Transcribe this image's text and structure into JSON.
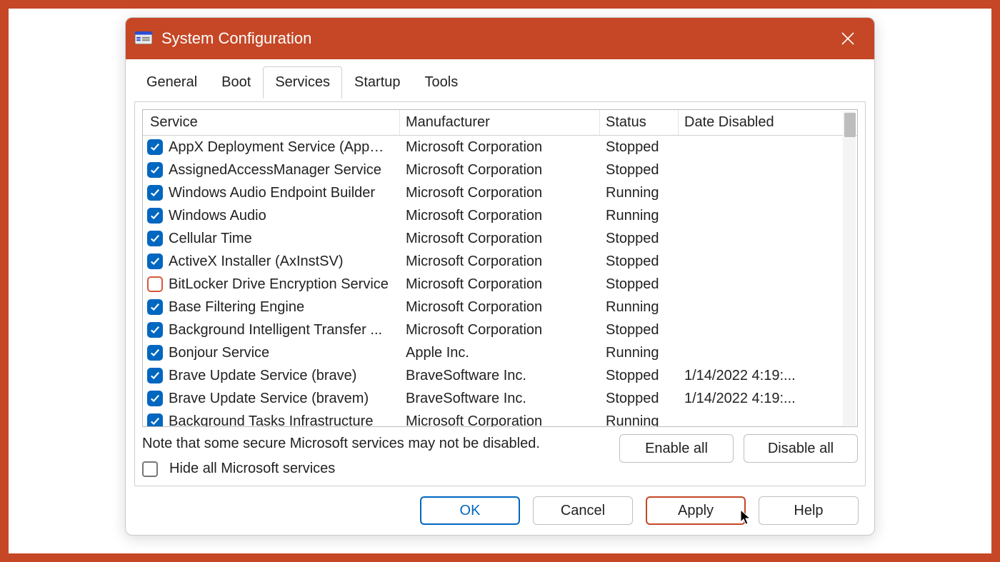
{
  "window": {
    "title": "System Configuration"
  },
  "tabs": [
    {
      "label": "General",
      "active": false
    },
    {
      "label": "Boot",
      "active": false
    },
    {
      "label": "Services",
      "active": true
    },
    {
      "label": "Startup",
      "active": false
    },
    {
      "label": "Tools",
      "active": false
    }
  ],
  "columns": {
    "service": "Service",
    "manufacturer": "Manufacturer",
    "status": "Status",
    "date_disabled": "Date Disabled"
  },
  "services": [
    {
      "checked": true,
      "name": "AppX Deployment Service (AppX...",
      "manufacturer": "Microsoft Corporation",
      "status": "Stopped",
      "date_disabled": ""
    },
    {
      "checked": true,
      "name": "AssignedAccessManager Service",
      "manufacturer": "Microsoft Corporation",
      "status": "Stopped",
      "date_disabled": ""
    },
    {
      "checked": true,
      "name": "Windows Audio Endpoint Builder",
      "manufacturer": "Microsoft Corporation",
      "status": "Running",
      "date_disabled": ""
    },
    {
      "checked": true,
      "name": "Windows Audio",
      "manufacturer": "Microsoft Corporation",
      "status": "Running",
      "date_disabled": ""
    },
    {
      "checked": true,
      "name": "Cellular Time",
      "manufacturer": "Microsoft Corporation",
      "status": "Stopped",
      "date_disabled": ""
    },
    {
      "checked": true,
      "name": "ActiveX Installer (AxInstSV)",
      "manufacturer": "Microsoft Corporation",
      "status": "Stopped",
      "date_disabled": ""
    },
    {
      "checked": false,
      "name": "BitLocker Drive Encryption Service",
      "manufacturer": "Microsoft Corporation",
      "status": "Stopped",
      "date_disabled": ""
    },
    {
      "checked": true,
      "name": "Base Filtering Engine",
      "manufacturer": "Microsoft Corporation",
      "status": "Running",
      "date_disabled": ""
    },
    {
      "checked": true,
      "name": "Background Intelligent Transfer ...",
      "manufacturer": "Microsoft Corporation",
      "status": "Stopped",
      "date_disabled": ""
    },
    {
      "checked": true,
      "name": "Bonjour Service",
      "manufacturer": "Apple Inc.",
      "status": "Running",
      "date_disabled": ""
    },
    {
      "checked": true,
      "name": "Brave Update Service (brave)",
      "manufacturer": "BraveSoftware Inc.",
      "status": "Stopped",
      "date_disabled": "1/14/2022 4:19:..."
    },
    {
      "checked": true,
      "name": "Brave Update Service (bravem)",
      "manufacturer": "BraveSoftware Inc.",
      "status": "Stopped",
      "date_disabled": "1/14/2022 4:19:..."
    },
    {
      "checked": true,
      "name": "Background Tasks Infrastructure",
      "manufacturer": "Microsoft Corporation",
      "status": "Running",
      "date_disabled": ""
    }
  ],
  "note": "Note that some secure Microsoft services may not be disabled.",
  "hide_label": "Hide all Microsoft services",
  "hide_checked": false,
  "buttons": {
    "enable_all": "Enable all",
    "disable_all": "Disable all",
    "ok": "OK",
    "cancel": "Cancel",
    "apply": "Apply",
    "help": "Help"
  }
}
